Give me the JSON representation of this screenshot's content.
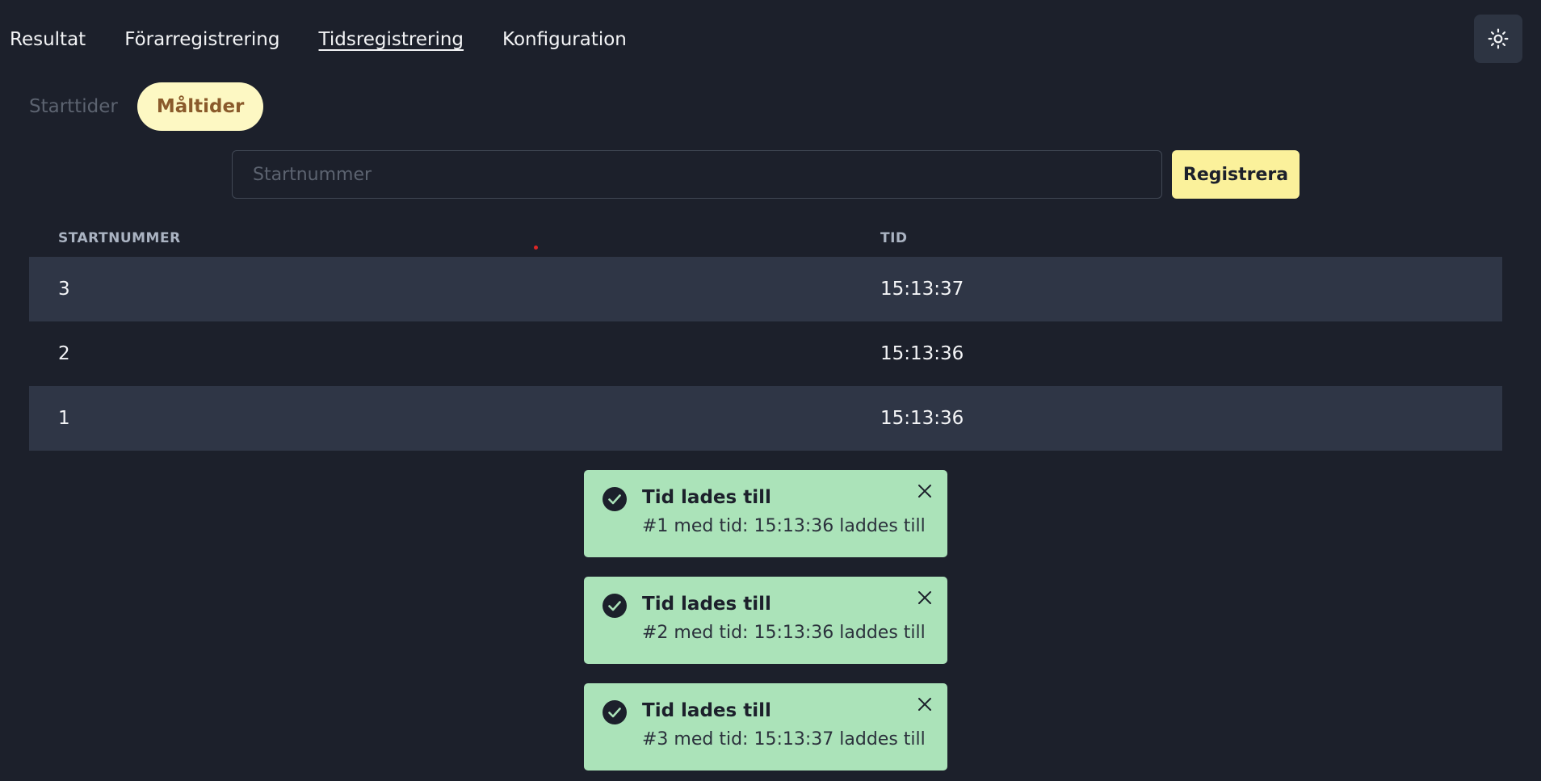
{
  "nav": {
    "items": [
      {
        "label": "Resultat",
        "active": false
      },
      {
        "label": "Förarregistrering",
        "active": false
      },
      {
        "label": "Tidsregistrering",
        "active": true
      },
      {
        "label": "Konfiguration",
        "active": false
      }
    ],
    "theme_toggle_icon": "sun-icon"
  },
  "tabs": [
    {
      "label": "Starttider",
      "active": false
    },
    {
      "label": "Måltider",
      "active": true
    }
  ],
  "form": {
    "input_placeholder": "Startnummer",
    "input_value": "",
    "register_label": "Registrera"
  },
  "table": {
    "headers": [
      "STARTNUMMER",
      "TID"
    ],
    "rows": [
      {
        "startnummer": "3",
        "tid": "15:13:37"
      },
      {
        "startnummer": "2",
        "tid": "15:13:36"
      },
      {
        "startnummer": "1",
        "tid": "15:13:36"
      }
    ]
  },
  "toasts": [
    {
      "title": "Tid lades till",
      "message": "#1 med tid: 15:13:36 laddes till"
    },
    {
      "title": "Tid lades till",
      "message": "#2 med tid: 15:13:36 laddes till"
    },
    {
      "title": "Tid lades till",
      "message": "#3 med tid: 15:13:37 laddes till"
    }
  ],
  "colors": {
    "background": "#1c202b",
    "striped_row": "#2f3646",
    "accent_button": "#fbf19b",
    "active_tab_bg": "#fdf8c3",
    "active_tab_text": "#8a5a2b",
    "toast_bg": "#abe3b9"
  }
}
